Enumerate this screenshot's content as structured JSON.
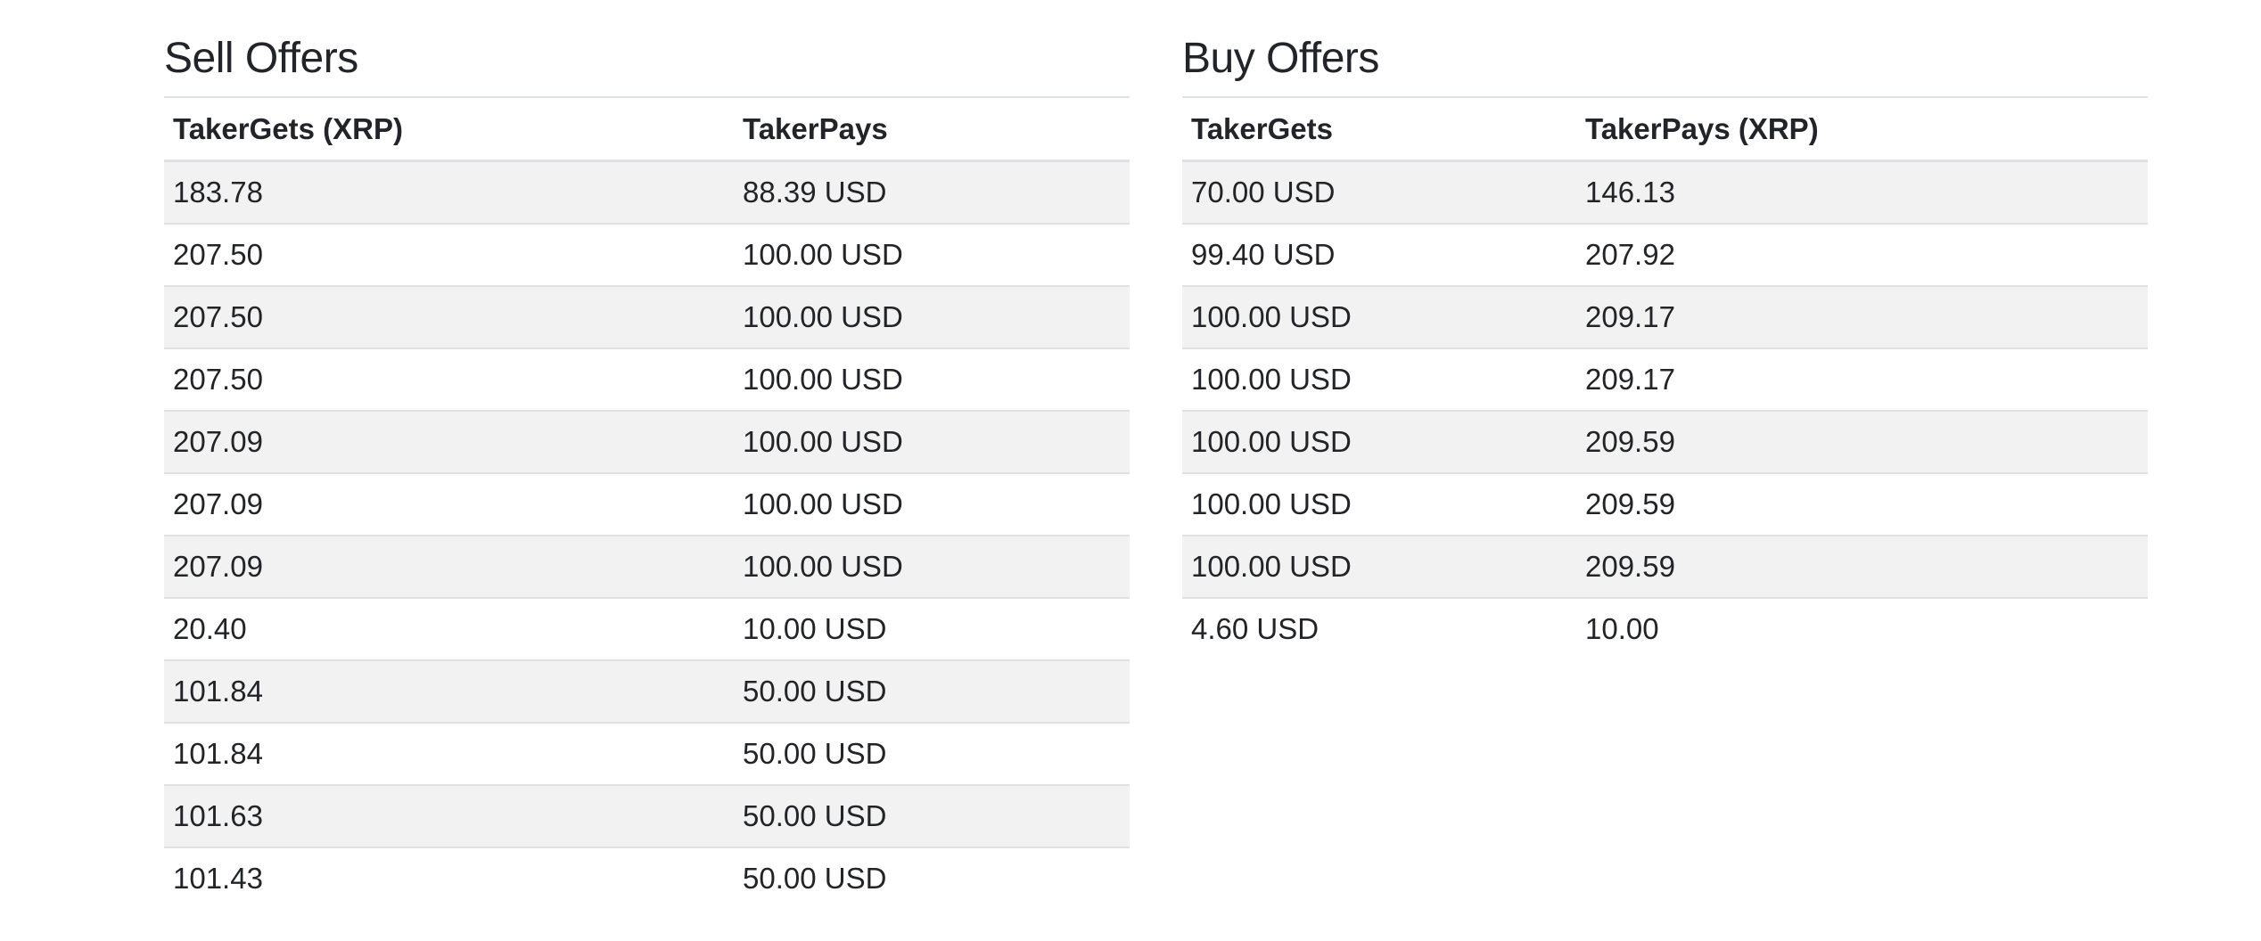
{
  "sell": {
    "title": "Sell Offers",
    "headers": [
      "TakerGets (XRP)",
      "TakerPays"
    ],
    "rows": [
      [
        "183.78",
        "88.39 USD"
      ],
      [
        "207.50",
        "100.00 USD"
      ],
      [
        "207.50",
        "100.00 USD"
      ],
      [
        "207.50",
        "100.00 USD"
      ],
      [
        "207.09",
        "100.00 USD"
      ],
      [
        "207.09",
        "100.00 USD"
      ],
      [
        "207.09",
        "100.00 USD"
      ],
      [
        "20.40",
        "10.00 USD"
      ],
      [
        "101.84",
        "50.00 USD"
      ],
      [
        "101.84",
        "50.00 USD"
      ],
      [
        "101.63",
        "50.00 USD"
      ],
      [
        "101.43",
        "50.00 USD"
      ]
    ]
  },
  "buy": {
    "title": "Buy Offers",
    "headers": [
      "TakerGets",
      "TakerPays (XRP)"
    ],
    "rows": [
      [
        "70.00 USD",
        "146.13"
      ],
      [
        "99.40 USD",
        "207.92"
      ],
      [
        "100.00 USD",
        "209.17"
      ],
      [
        "100.00 USD",
        "209.17"
      ],
      [
        "100.00 USD",
        "209.59"
      ],
      [
        "100.00 USD",
        "209.59"
      ],
      [
        "100.00 USD",
        "209.59"
      ],
      [
        "4.60 USD",
        "10.00"
      ]
    ]
  },
  "colors": {
    "text": "#212529",
    "stripe": "#f2f2f2",
    "border": "#dee2e6"
  }
}
